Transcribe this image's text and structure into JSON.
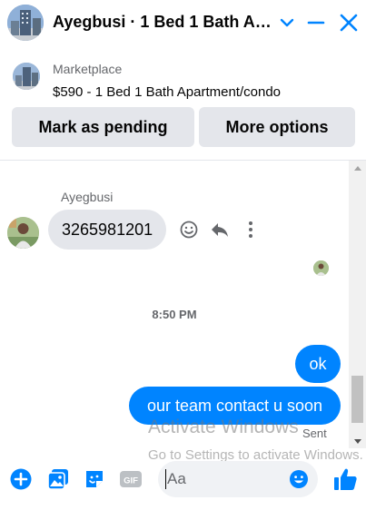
{
  "header": {
    "title": "Ayegbusi · 1 Bed 1 Bath Apartment/condo",
    "accent": "#0084ff"
  },
  "marketplace": {
    "source": "Marketplace",
    "listing": "$590 - 1 Bed 1 Bath Apartment/condo",
    "buttons": {
      "mark_pending": "Mark as pending",
      "more_options": "More options"
    }
  },
  "conversation": {
    "incoming": {
      "sender": "Ayegbusi",
      "text": "3265981201",
      "actions": [
        "smiley-icon",
        "reply-icon",
        "more-vertical-icon"
      ]
    },
    "timestamp": "8:50 PM",
    "outgoing": [
      {
        "text": "ok"
      },
      {
        "text": "our team contact u soon"
      }
    ],
    "status": "Sent"
  },
  "watermark": {
    "line1": "Activate Windows",
    "line2": "Go to Settings to activate Windows."
  },
  "composer": {
    "placeholder": "Aa",
    "icons": [
      "plus-icon",
      "photo-icon",
      "sticker-icon",
      "gif-icon",
      "emoji-icon",
      "thumbs-up-icon"
    ]
  },
  "colors": {
    "brand_blue": "#0084ff",
    "bubble_gray": "#e4e6eb",
    "muted_text": "#65676b"
  }
}
